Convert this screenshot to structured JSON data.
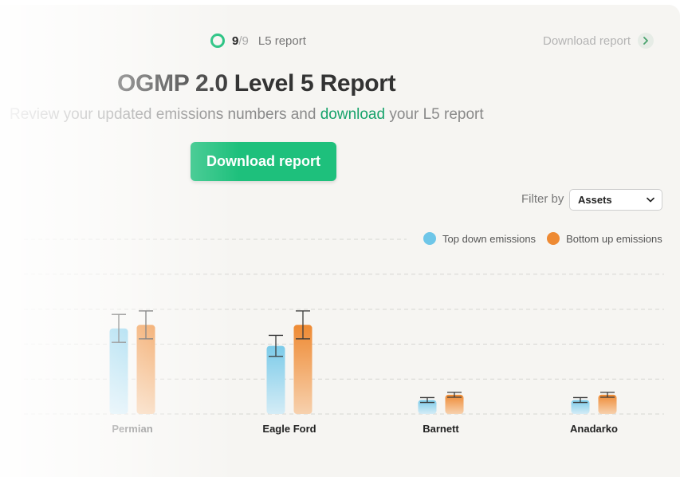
{
  "progress": {
    "current": "9",
    "separator": "/",
    "total": "9",
    "label": "L5 report",
    "ring_color": "#1ec07c",
    "fraction": 1
  },
  "header": {
    "download_link": "Download report"
  },
  "title": "OGMP 2.0 Level 5 Report",
  "subtitle": {
    "before": "Review your updated emissions numbers and ",
    "highlight": "download",
    "after": " your L5 report"
  },
  "primary_button": {
    "label": "Download report",
    "color": "#1ec07c"
  },
  "filter": {
    "label": "Filter by",
    "selected": "Assets"
  },
  "legend": [
    {
      "name": "Top down emissions",
      "color": "#6ec6e8"
    },
    {
      "name": "Bottom up emissions",
      "color": "#ee8a33"
    }
  ],
  "chart_data": {
    "type": "bar",
    "categories": [
      "Permian",
      "Eagle Ford",
      "Barnett",
      "Anadarko"
    ],
    "ylim": [
      0,
      5
    ],
    "grid": true,
    "legend_position": "top-right",
    "series": [
      {
        "name": "Top down emissions",
        "color": "#6ec6e8",
        "values": [
          2.45,
          1.95,
          0.4,
          0.4
        ],
        "error_low": [
          2.05,
          1.65,
          0.33,
          0.33
        ],
        "error_high": [
          2.85,
          2.25,
          0.47,
          0.47
        ]
      },
      {
        "name": "Bottom up emissions",
        "color": "#ee8a33",
        "values": [
          2.55,
          2.55,
          0.55,
          0.55
        ],
        "error_low": [
          2.15,
          2.15,
          0.48,
          0.48
        ],
        "error_high": [
          2.95,
          2.95,
          0.62,
          0.62
        ]
      }
    ]
  }
}
